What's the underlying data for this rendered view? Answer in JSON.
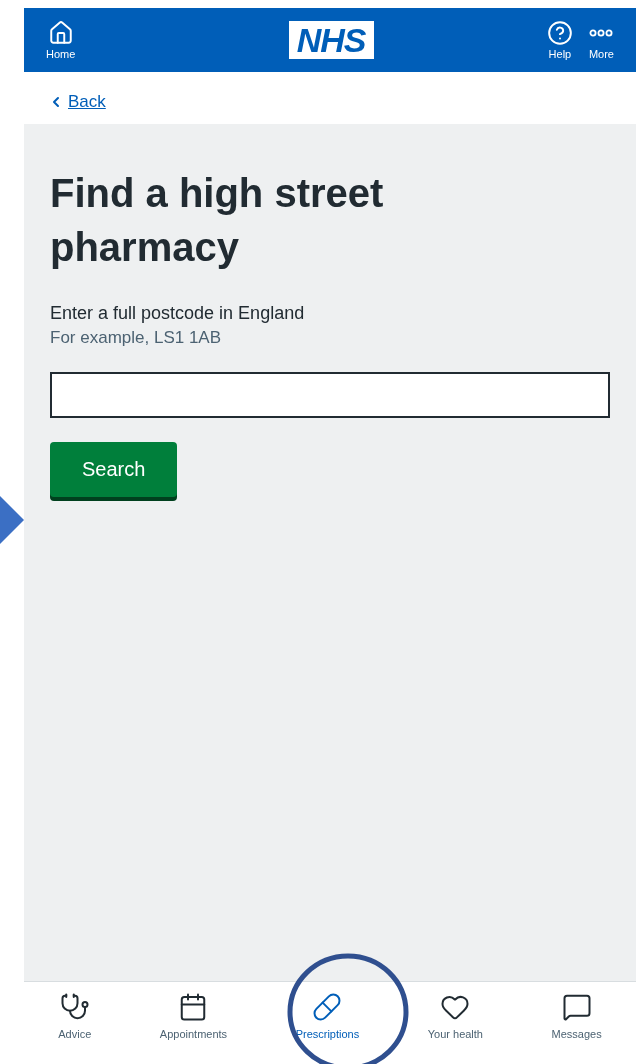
{
  "header": {
    "logo": "NHS",
    "items": [
      {
        "kind": "home",
        "label": "Home"
      },
      {
        "kind": "help",
        "label": "Help"
      },
      {
        "kind": "more",
        "label": "More"
      }
    ]
  },
  "back_link": "Back",
  "title": "Find a high street pharmacy",
  "postcode_field": {
    "label": "Enter a full postcode in England",
    "hint": "For example, LS1 1AB"
  },
  "search_button": "Search",
  "bottom_nav": [
    {
      "kind": "advice",
      "label": "Advice",
      "selected": false
    },
    {
      "kind": "appointments",
      "label": "Appointments",
      "selected": false
    },
    {
      "kind": "prescriptions",
      "label": "Prescriptions",
      "selected": true
    },
    {
      "kind": "health",
      "label": "Your health",
      "selected": false
    },
    {
      "kind": "messages",
      "label": "Messages",
      "selected": false
    }
  ]
}
